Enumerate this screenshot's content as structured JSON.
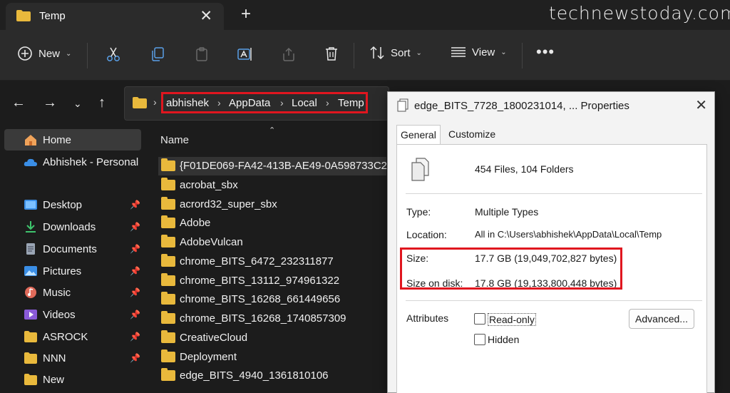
{
  "tab": {
    "title": "Temp"
  },
  "watermark": "technewstoday.com",
  "toolbar": {
    "new_label": "New",
    "sort_label": "Sort",
    "view_label": "View"
  },
  "address": {
    "crumbs": [
      "abhishek",
      "AppData",
      "Local",
      "Temp"
    ]
  },
  "sidebar": {
    "items": [
      {
        "label": "Home",
        "icon": "home-icon"
      },
      {
        "label": "Abhishek - Personal",
        "icon": "cloud-icon"
      },
      {
        "label": "Desktop",
        "icon": "desktop-icon",
        "pinned": true
      },
      {
        "label": "Downloads",
        "icon": "download-icon",
        "pinned": true
      },
      {
        "label": "Documents",
        "icon": "document-icon",
        "pinned": true
      },
      {
        "label": "Pictures",
        "icon": "pictures-icon",
        "pinned": true
      },
      {
        "label": "Music",
        "icon": "music-icon",
        "pinned": true
      },
      {
        "label": "Videos",
        "icon": "videos-icon",
        "pinned": true
      },
      {
        "label": "ASROCK",
        "icon": "folder-icon",
        "pinned": true
      },
      {
        "label": "NNN",
        "icon": "folder-icon",
        "pinned": true
      },
      {
        "label": "New",
        "icon": "folder-icon",
        "pinned": false
      }
    ]
  },
  "filelist": {
    "column_header": "Name",
    "rows": [
      "{F01DE069-FA42-413B-AE49-0A598733C2...",
      "acrobat_sbx",
      "acrord32_super_sbx",
      "Adobe",
      "AdobeVulcan",
      "chrome_BITS_6472_232311877",
      "chrome_BITS_13112_974961322",
      "chrome_BITS_16268_661449656",
      "chrome_BITS_16268_1740857309",
      "CreativeCloud",
      "Deployment",
      "edge_BITS_4940_1361810106"
    ]
  },
  "dialog": {
    "title": "edge_BITS_7728_1800231014, ... Properties",
    "tabs": [
      "General",
      "Customize"
    ],
    "summary": "454 Files, 104 Folders",
    "type_label": "Type:",
    "type_value": "Multiple Types",
    "location_label": "Location:",
    "location_value": "All in C:\\Users\\abhishek\\AppData\\Local\\Temp",
    "size_label": "Size:",
    "size_value": "17.7 GB (19,049,702,827 bytes)",
    "size_on_disk_label": "Size on disk:",
    "size_on_disk_value": "17.8 GB (19,133,800,448 bytes)",
    "attributes_label": "Attributes",
    "readonly_label": "Read-only",
    "hidden_label": "Hidden",
    "advanced_label": "Advanced..."
  },
  "colors": {
    "highlight": "#e0161f",
    "folder": "#e9b93c"
  }
}
